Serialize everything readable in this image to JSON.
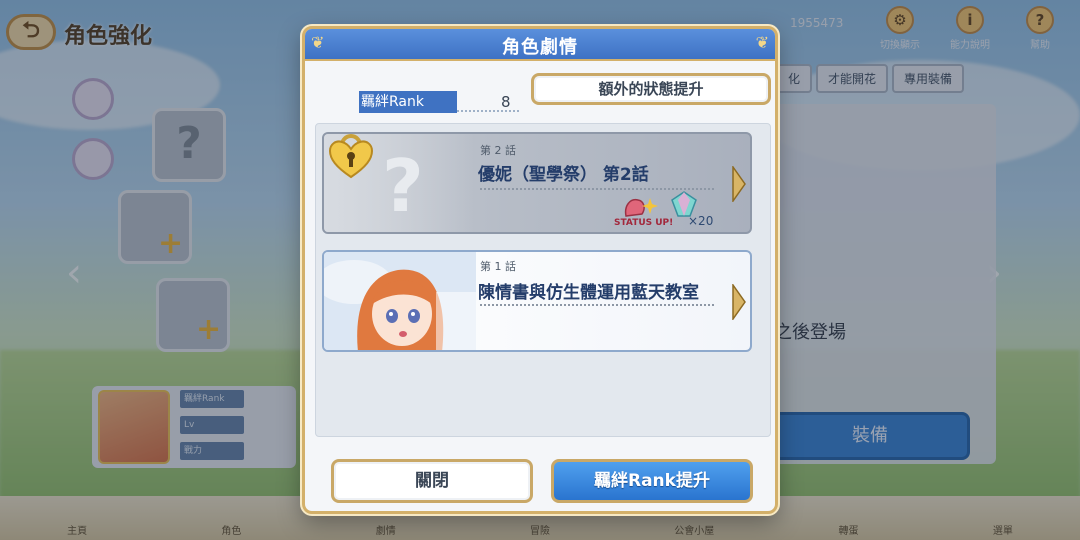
{
  "background": {
    "screen_title": "角色強化",
    "back_icon": "back-arrow-icon",
    "currency_value": "1955473",
    "top_icons": [
      {
        "icon": "settings-icon",
        "label": "切換顯示"
      },
      {
        "icon": "info-icon",
        "label": "能力說明"
      },
      {
        "icon": "help-icon",
        "label": "幫助"
      }
    ],
    "right_tabs": [
      "化",
      "才能開花",
      "專用裝備"
    ],
    "right_panel_text": "之後登場",
    "equip_button": "裝備",
    "stat_rows": [
      "羈絆Rank",
      "Lv",
      "戰力"
    ],
    "nav_items": [
      "主頁",
      "角色",
      "劇情",
      "冒險",
      "公會小屋",
      "轉蛋",
      "選單"
    ]
  },
  "modal": {
    "title": "角色劇情",
    "rank_label": "羈絆Rank",
    "rank_value": "8",
    "extra_status_button": "額外的狀態提升",
    "episodes": [
      {
        "number": "第 2 話",
        "title": "優妮（聖學祭） 第2話",
        "locked": true,
        "lock_icon": "heart-lock-icon",
        "placeholder_icon": "question-mark-icon",
        "rewards": [
          {
            "icon": "status-up-icon",
            "label": "STATUS UP!"
          },
          {
            "icon": "jewel-icon",
            "label": "×20"
          }
        ]
      },
      {
        "number": "第 1 話",
        "title": "陳情書與仿生體運用藍天教室",
        "locked": false
      }
    ],
    "close_button": "關閉",
    "rankup_button": "羈絆Rank提升"
  },
  "colors": {
    "header_blue": "#3e72c4",
    "gold_border": "#d3b06a",
    "primary_button": "#2a74cf",
    "title_text": "#243d6a"
  }
}
